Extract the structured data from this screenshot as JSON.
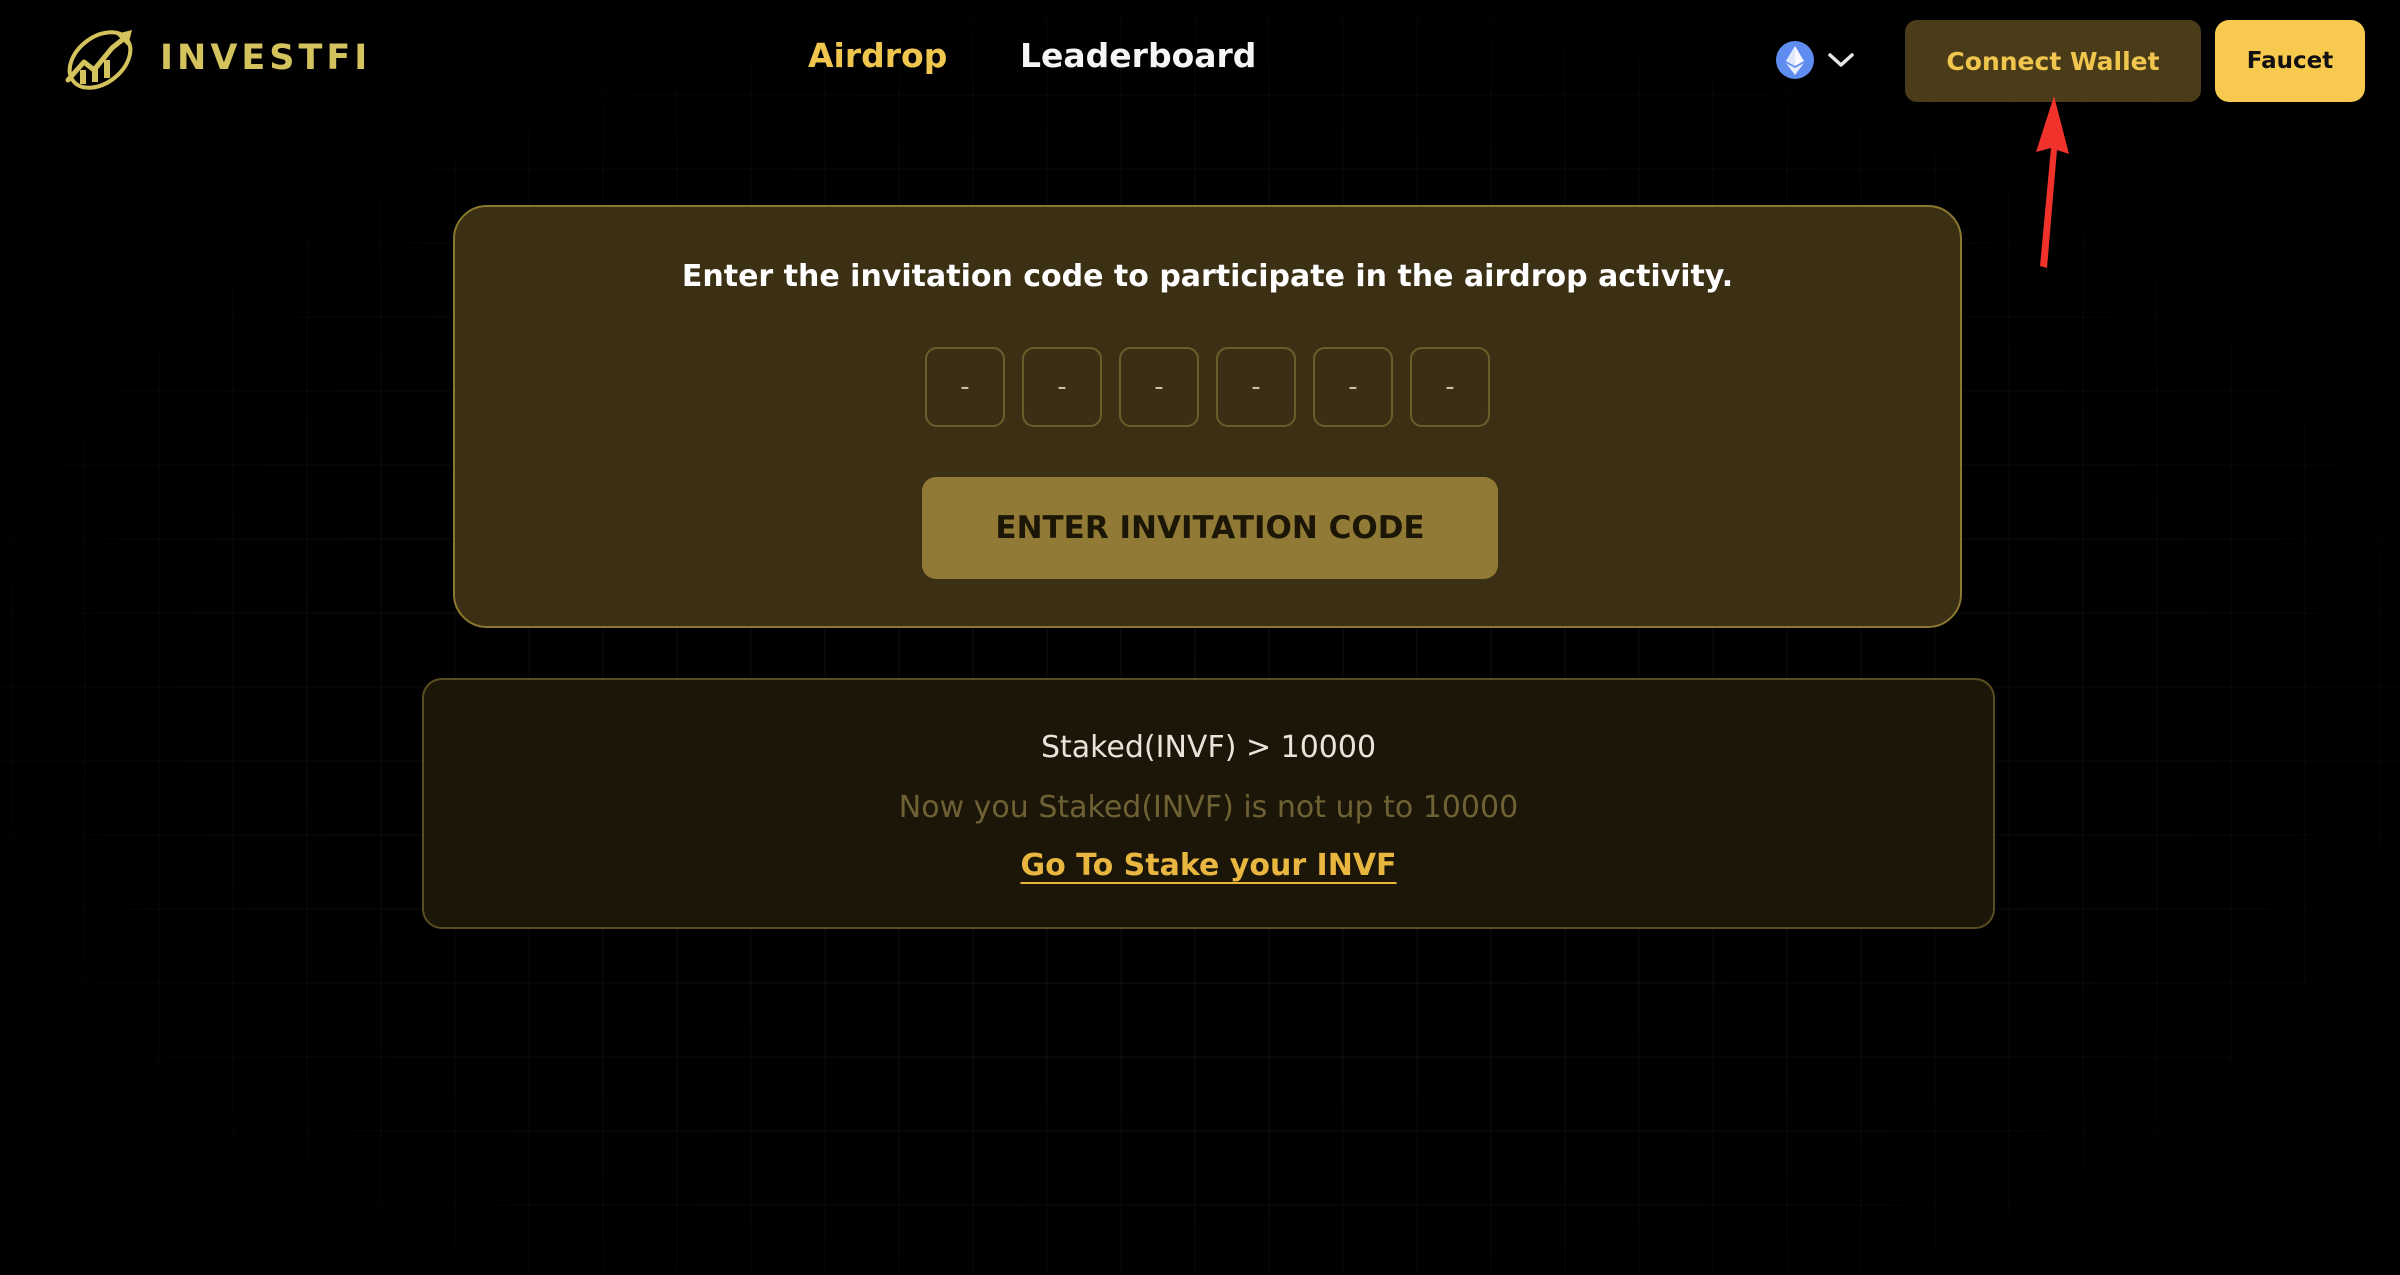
{
  "brand": {
    "name": "INVESTFI",
    "color": "#d4c25c"
  },
  "nav": {
    "items": [
      {
        "label": "Airdrop",
        "active": true,
        "color": "#f0c64e"
      },
      {
        "label": "Leaderboard",
        "active": false,
        "color": "#f5f5f5"
      }
    ]
  },
  "network": {
    "icon": "ethereum-icon",
    "chevron": "chevron-down-icon"
  },
  "header": {
    "connect_wallet_label": "Connect Wallet",
    "connect_wallet_bg": "#4b3c19",
    "connect_wallet_color": "#f0c64e",
    "faucet_label": "Faucet",
    "faucet_bg": "#f7c94e"
  },
  "annotation": {
    "icon": "red-arrow-icon",
    "color": "#f0322a"
  },
  "invite": {
    "title": "Enter the invitation code to participate in the airdrop activity.",
    "code_placeholders": [
      "-",
      "-",
      "-",
      "-",
      "-",
      "-"
    ],
    "button_label": "ENTER INVITATION CODE"
  },
  "stake": {
    "requirement": "Staked(INVF) > 10000",
    "status": "Now you Staked(INVF) is not up to 10000",
    "link_label": "Go To Stake your INVF"
  }
}
